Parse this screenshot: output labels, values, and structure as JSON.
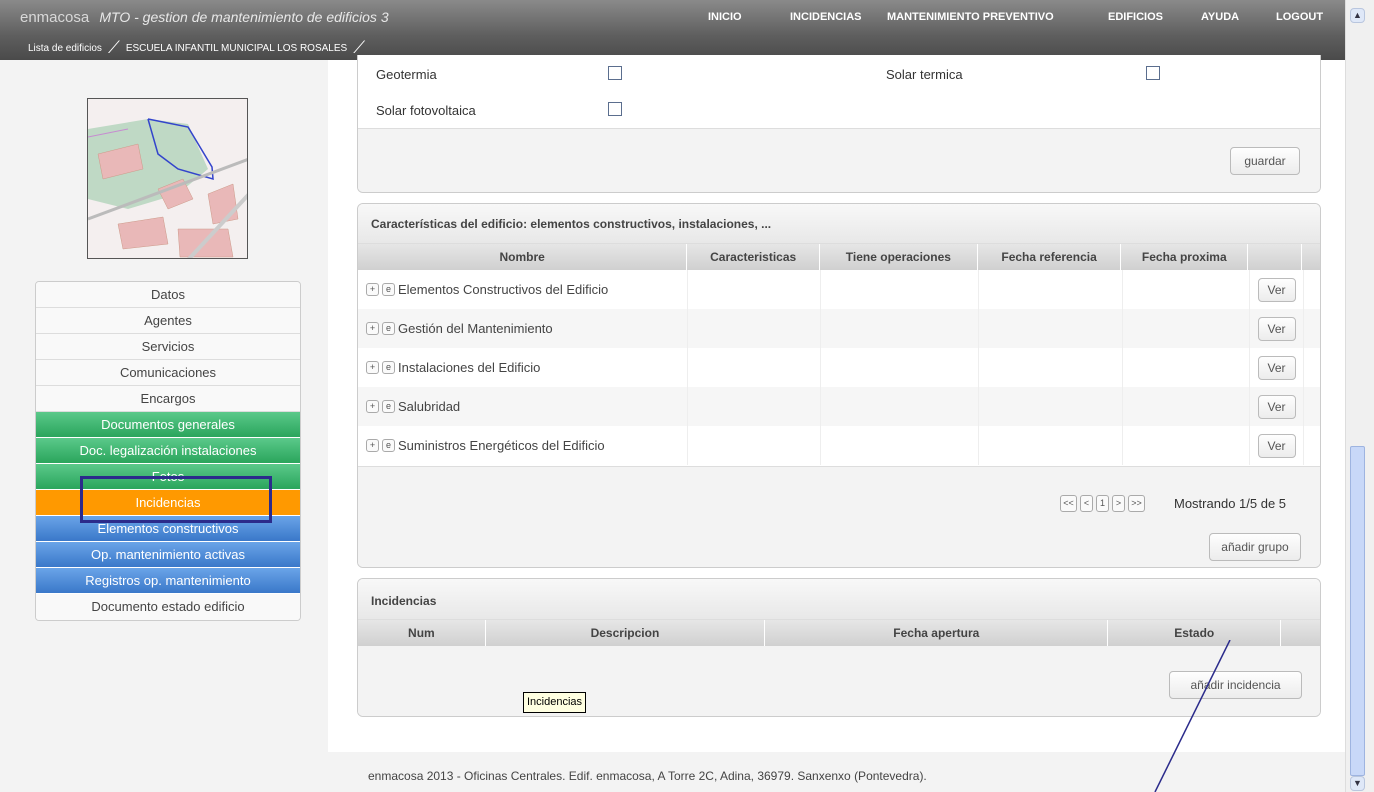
{
  "header": {
    "brand": "enmacosa",
    "app_title": "MTO - gestion de mantenimiento de edificios 3",
    "breadcrumb": [
      "Lista de edificios",
      "ESCUELA INFANTIL MUNICIPAL LOS ROSALES"
    ],
    "nav": [
      "INICIO",
      "INCIDENCIAS",
      "MANTENIMIENTO PREVENTIVO",
      "EDIFICIOS",
      "AYUDA",
      "LOGOUT"
    ]
  },
  "sidebar": {
    "items": [
      {
        "label": "Datos"
      },
      {
        "label": "Agentes"
      },
      {
        "label": "Servicios"
      },
      {
        "label": "Comunicaciones"
      },
      {
        "label": "Encargos"
      },
      {
        "label": "Documentos generales"
      },
      {
        "label": "Doc. legalización instalaciones"
      },
      {
        "label": "Fotos"
      },
      {
        "label": "Incidencias"
      },
      {
        "label": "Elementos constructivos"
      },
      {
        "label": "Op. mantenimiento activas"
      },
      {
        "label": "Registros op. mantenimiento"
      },
      {
        "label": "Documento estado edificio"
      }
    ]
  },
  "energy": {
    "fields": [
      "Geotermia",
      "Solar termica",
      "Solar fotovoltaica"
    ],
    "save_label": "guardar"
  },
  "caracteristicas": {
    "title": "Características del edificio: elementos constructivos, instalaciones, ...",
    "columns": [
      "Nombre",
      "Caracteristicas",
      "Tiene operaciones",
      "Fecha referencia",
      "Fecha proxima"
    ],
    "rows": [
      "Elementos Constructivos del Edificio",
      "Gestión del Mantenimiento",
      "Instalaciones del Edificio",
      "Salubridad",
      "Suministros Energéticos del Edificio"
    ],
    "row_button": "Ver",
    "expand_symbol": "+",
    "edit_symbol": "e",
    "pager": [
      "<<",
      "<",
      "1",
      ">",
      ">>"
    ],
    "pager_status": "Mostrando 1/5 de 5",
    "add_label": "añadir grupo"
  },
  "incidencias": {
    "title": "Incidencias",
    "columns": [
      "Num",
      "Descripcion",
      "Fecha apertura",
      "Estado"
    ],
    "add_label": "añadir incidencia"
  },
  "tooltip": "Incidencias",
  "footer": "enmacosa 2013 - Oficinas Centrales. Edif. enmacosa, A Torre 2C, Adina, 36979. Sanxenxo (Pontevedra)."
}
